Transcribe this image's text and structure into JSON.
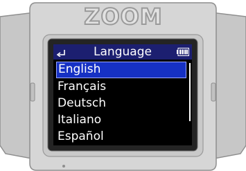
{
  "device": {
    "brand_logo": "ZOOM"
  },
  "header": {
    "title": "Language",
    "back_icon": "back-arrow-icon",
    "battery_icon": "battery-full-icon"
  },
  "languages": {
    "items": [
      {
        "label": "English",
        "selected": true
      },
      {
        "label": "Français",
        "selected": false
      },
      {
        "label": "Deutsch",
        "selected": false
      },
      {
        "label": "Italiano",
        "selected": false
      },
      {
        "label": "Español",
        "selected": false
      }
    ]
  },
  "colors": {
    "title_bar": "#1c1f70",
    "selection": "#1631c4",
    "screen_background": "#000000"
  }
}
